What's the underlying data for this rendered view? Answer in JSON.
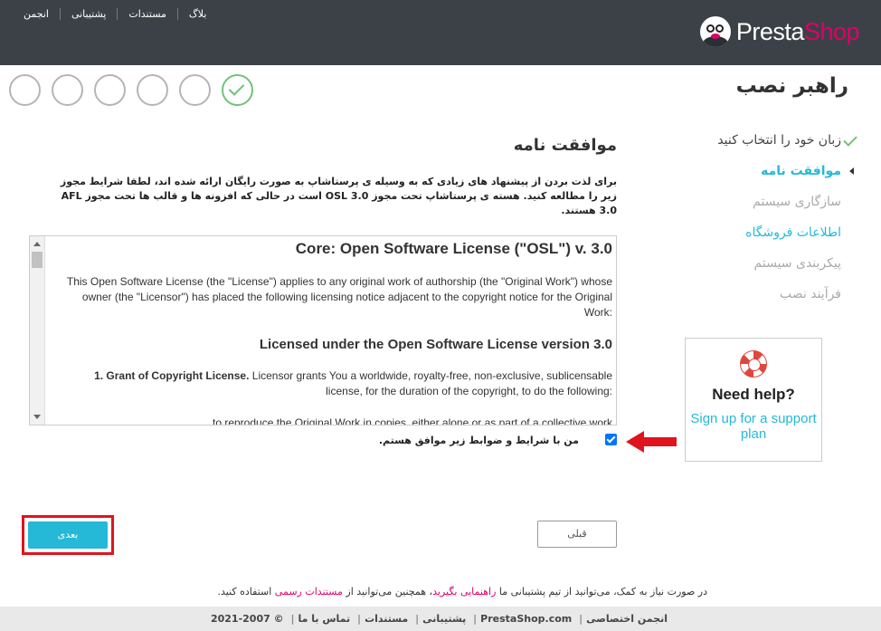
{
  "header": {
    "links": [
      "بلاگ",
      "مستندات",
      "پشتیبانی",
      "انجمن"
    ],
    "logo_part1": "Presta",
    "logo_part2": "Shop"
  },
  "wizard_title": "راهبر نصب",
  "steps_progress": {
    "total": 6,
    "completed": 1
  },
  "sidebar": {
    "items": [
      {
        "label": "زبان خود را انتخاب کنید",
        "state": "done"
      },
      {
        "label": "موافقت نامه",
        "state": "active"
      },
      {
        "label": "سازگاری سیستم",
        "state": "future"
      },
      {
        "label": "اطلاعات فروشگاه",
        "state": "link"
      },
      {
        "label": "پیکربندی سیستم",
        "state": "future"
      },
      {
        "label": "فرآیند نصب",
        "state": "future"
      }
    ]
  },
  "help": {
    "title": "Need help?",
    "link": "Sign up for a support plan"
  },
  "content": {
    "title": "موافقت نامه",
    "intro": "برای لذت بردن از پیشنهاد های زیادی که به وسیله ی پرستاشاپ به صورت رایگان ارائه شده اند، لطفا شرایط مجوز زیر را مطالعه کنید. هسته ی پرستاشاپ تحت مجوز OSL 3.0 است در حالی که افزونه ها و قالب ها تحت مجوز AFL 3.0 هستند.",
    "license": {
      "heading": "Core: Open Software License (\"OSL\") v. 3.0",
      "para1": "This Open Software License (the \"License\") applies to any original work of authorship (the \"Original Work\") whose owner (the \"Licensor\") has placed the following licensing notice adjacent to the copyright notice for the Original Work:",
      "heading2": "Licensed under the Open Software License version 3.0",
      "grant_bold": "1. Grant of Copyright License.",
      "grant_text": " Licensor grants You a worldwide, royalty-free, non-exclusive, sublicensable license, for the duration of the copyright, to do the following:",
      "para3": "to reproduce the Original Work in copies, either alone or as part of a collective work"
    },
    "agree_label": "من با شرایط و ضوابط زیر موافق هستم.",
    "agree_checked": true
  },
  "buttons": {
    "next": "بعدی",
    "prev": "قبلی"
  },
  "footer": {
    "help_text_1": "در صورت نیاز به کمک، می‌توانید از تیم پشتیبانی ما ",
    "help_link_1": "راهنمایی بگیرید",
    "help_text_2": "، همچنین می‌توانید از ",
    "help_link_2": "مستندات رسمی",
    "help_text_3": " استفاده کنید.",
    "links": [
      "انجمن اختصاصی",
      "PrestaShop.com",
      "پشتیبانی",
      "مستندات",
      "تماس با ما",
      "© 2007-2021"
    ]
  },
  "colors": {
    "accent": "#25b9d7",
    "brand": "#df0067",
    "success": "#72c279",
    "highlight": "#e0141e"
  }
}
